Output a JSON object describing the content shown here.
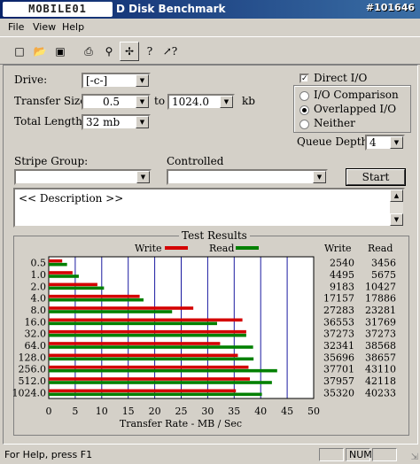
{
  "window": {
    "brand": "MOBILE01",
    "title": "D Disk Benchmark",
    "watermark": "#101646"
  },
  "menu": [
    "File",
    "View",
    "Help"
  ],
  "toolbar": [
    "new-icon",
    "open-icon",
    "save-icon",
    "print-icon",
    "print-preview-icon",
    "move-icon",
    "help-icon",
    "context-help-icon"
  ],
  "form": {
    "drive_label": "Drive:",
    "drive_value": "[-c-]",
    "transfer_size_label": "Transfer Size:",
    "transfer_from": "0.5",
    "to_label": "to",
    "transfer_to": "1024.0",
    "kb_label": "kb",
    "total_length_label": "Total Length:",
    "total_length_value": "32 mb",
    "direct_io_label": "Direct I/O",
    "direct_io_checked": true,
    "io_options": [
      "I/O Comparison",
      "Overlapped I/O",
      "Neither"
    ],
    "io_selected": "Overlapped I/O",
    "queue_depth_label": "Queue Depth:",
    "queue_depth_value": "4",
    "stripe_group_label": "Stripe Group:",
    "controlled_label": "Controlled",
    "start_label": "Start",
    "description": "<< Description >>"
  },
  "results": {
    "group_title": "Test Results",
    "write_header": "Write",
    "read_header": "Read"
  },
  "chart_data": {
    "type": "bar",
    "orientation": "horizontal",
    "xlabel": "Transfer Rate - MB / Sec",
    "xlim": [
      0,
      50
    ],
    "xticks": [
      0,
      5,
      10,
      15,
      20,
      25,
      30,
      35,
      40,
      45,
      50
    ],
    "grid": true,
    "legend": "top",
    "categories": [
      "0.5",
      "1.0",
      "2.0",
      "4.0",
      "8.0",
      "16.0",
      "32.0",
      "64.0",
      "128.0",
      "256.0",
      "512.0",
      "1024.0"
    ],
    "series": [
      {
        "name": "Write",
        "color": "#d40000",
        "values": [
          2540,
          4495,
          9183,
          17157,
          27283,
          36553,
          37273,
          32341,
          35696,
          37701,
          37957,
          35320
        ]
      },
      {
        "name": "Read",
        "color": "#008000",
        "values": [
          3456,
          5675,
          10427,
          17886,
          23281,
          31769,
          37273,
          38568,
          38657,
          43110,
          42118,
          40233
        ]
      }
    ],
    "value_divisor": 1000
  },
  "status": {
    "help_text": "For Help, press F1",
    "num": "NUM"
  }
}
